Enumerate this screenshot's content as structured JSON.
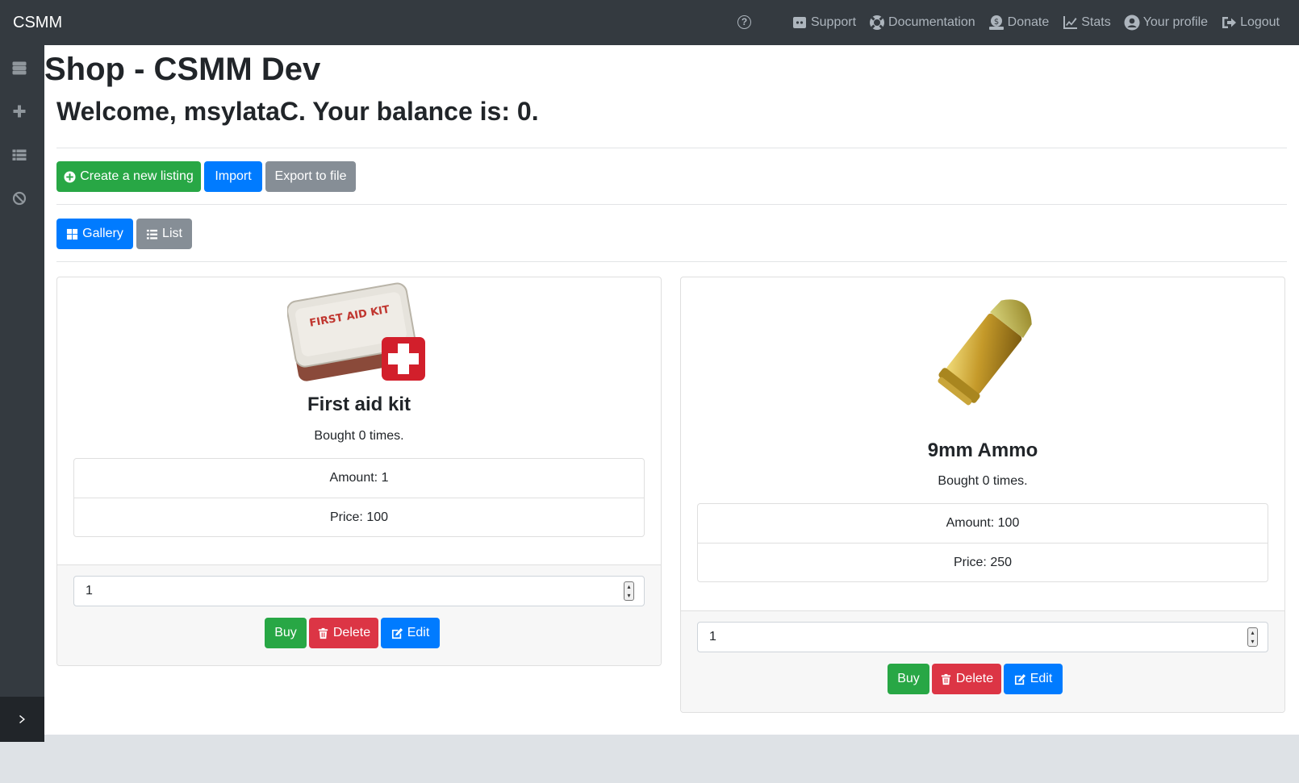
{
  "app": {
    "brand": "CSMM"
  },
  "nav": {
    "help_symbol": "?",
    "links": [
      {
        "label": "Support",
        "icon": "discord-icon"
      },
      {
        "label": "Documentation",
        "icon": "life-ring-icon"
      },
      {
        "label": "Donate",
        "icon": "donate-icon"
      },
      {
        "label": "Stats",
        "icon": "chart-line-icon"
      },
      {
        "label": "Your profile",
        "icon": "user-circle-icon"
      },
      {
        "label": "Logout",
        "icon": "sign-out-icon"
      }
    ]
  },
  "sidebar": {
    "icons": [
      "servers-icon",
      "plus-icon",
      "list-icon",
      "ban-icon"
    ],
    "toggle_icon": "chevron-right-icon"
  },
  "page": {
    "title": "Shop - CSMM Dev",
    "welcome": "Welcome, msylataC. Your balance is: 0."
  },
  "toolbar": {
    "create_label": "Create a new listing",
    "import_label": "Import",
    "export_label": "Export to file"
  },
  "view": {
    "gallery_label": "Gallery",
    "list_label": "List"
  },
  "listings": [
    {
      "name": "First aid kit",
      "bought": "Bought 0 times.",
      "amount": "Amount: 1",
      "price": "Price: 100",
      "image_text": "FIRST AID KIT",
      "quantity": "1",
      "buy_label": "Buy",
      "delete_label": "Delete",
      "edit_label": "Edit"
    },
    {
      "name": "9mm Ammo",
      "bought": "Bought 0 times.",
      "amount": "Amount: 100",
      "price": "Price: 250",
      "quantity": "1",
      "buy_label": "Buy",
      "delete_label": "Delete",
      "edit_label": "Edit"
    }
  ],
  "colors": {
    "navbar": "#343a40",
    "success": "#28a745",
    "primary": "#007bff",
    "secondary": "#868e96",
    "danger": "#dc3545"
  }
}
